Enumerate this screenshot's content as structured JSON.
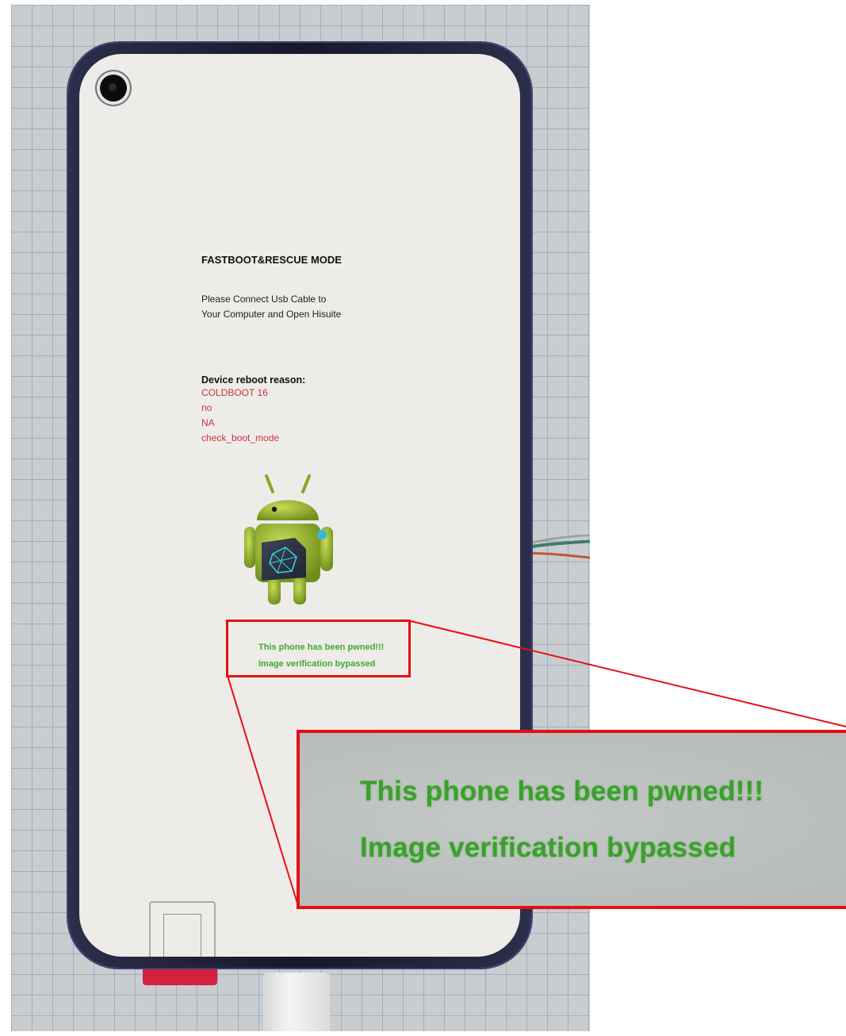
{
  "screen": {
    "title": "FASTBOOT&RESCUE MODE",
    "instructions": [
      "Please Connect Usb Cable to",
      "Your Computer and Open Hisuite"
    ],
    "reboot_reason_label": "Device reboot reason:",
    "reboot_reasons": [
      "COLDBOOT  16",
      "no",
      "NA",
      "check_boot_mode"
    ],
    "pwned_lines": [
      "This phone has been pwned!!!",
      "Image verification bypassed"
    ]
  },
  "zoom": {
    "lines": [
      "This phone has been pwned!!!",
      "Image verification bypassed"
    ]
  },
  "colors": {
    "highlight": "#e60f12",
    "pwned_text": "#3ea832",
    "reason_text": "#c8343e"
  },
  "icons": [
    "android-robot-icon",
    "front-camera-icon"
  ]
}
